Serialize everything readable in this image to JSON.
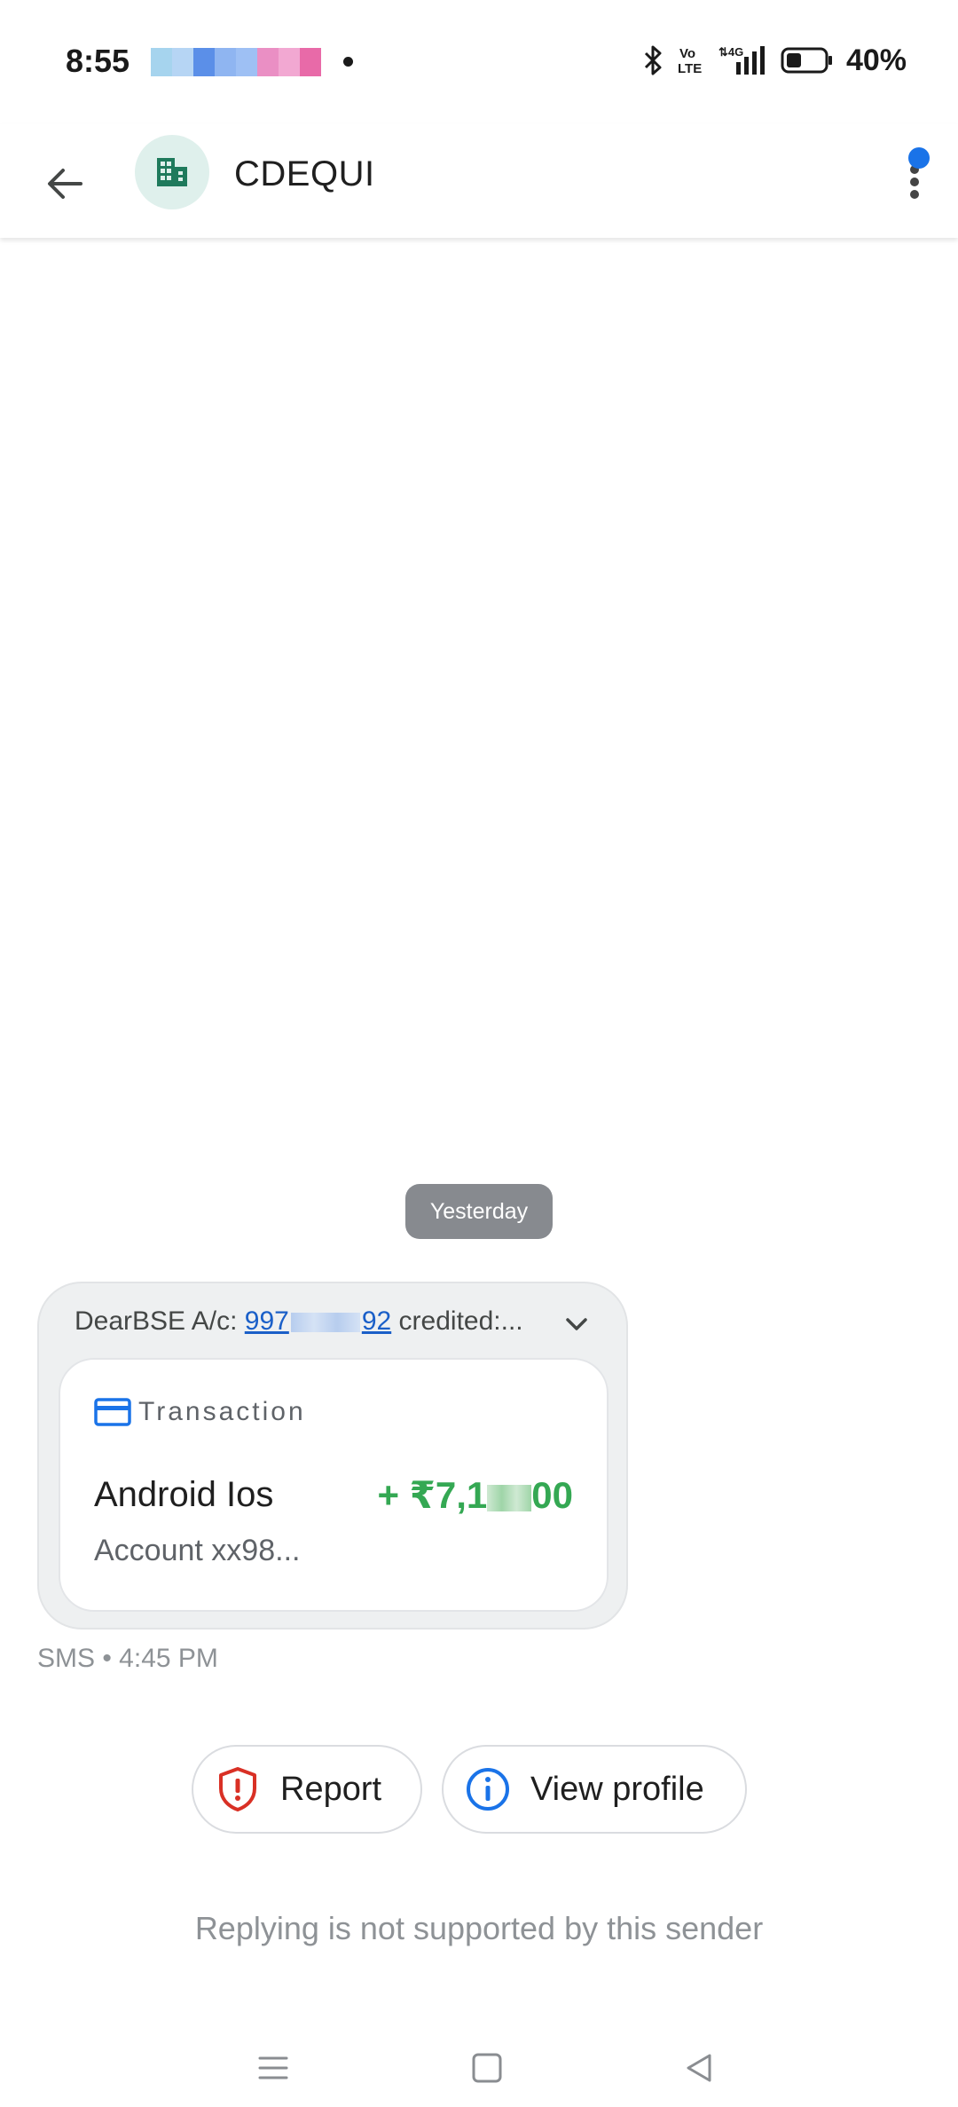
{
  "status_bar": {
    "time": "8:55",
    "battery_percent": "40%",
    "network": "4G",
    "volte": "Vo LTE",
    "notification_colors": [
      "#a6d4ee",
      "#b6d5f4",
      "#5b8fe8",
      "#8fb5f1",
      "#9ec0f4",
      "#ea8fc4",
      "#f2a8d2",
      "#e86aa8"
    ]
  },
  "app_bar": {
    "title": "CDEQUI",
    "avatar_icon": "business-icon",
    "accent": "#1f7a5c"
  },
  "conversation": {
    "date_divider": "Yesterday",
    "message": {
      "prefix": "DearBSE  A/c:",
      "account_start": "997",
      "account_end": "92",
      "suffix": "credited:...",
      "card": {
        "type_label": "Transaction",
        "merchant": "Android Ios",
        "amount_prefix": "+ ₹7,1",
        "amount_suffix": "00",
        "account": "Account xx98..."
      },
      "meta": "SMS • 4:45 PM"
    }
  },
  "actions": {
    "report_label": "Report",
    "view_profile_label": "View profile"
  },
  "footer": {
    "notice": "Replying is not supported by this sender"
  },
  "colors": {
    "amount_green": "#34a853",
    "link_blue": "#1a5fc8",
    "report_red": "#d93025",
    "info_blue": "#1a73e8"
  }
}
